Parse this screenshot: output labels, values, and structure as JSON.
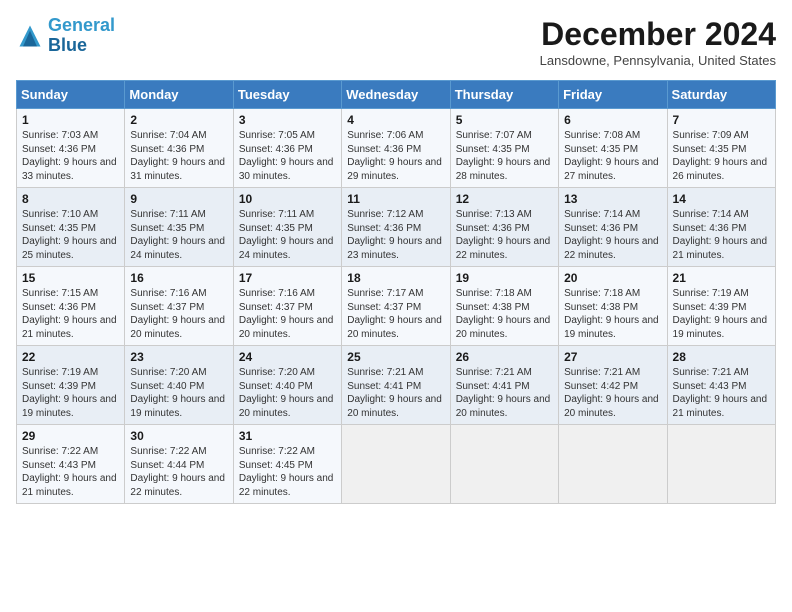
{
  "header": {
    "logo_line1": "General",
    "logo_line2": "Blue",
    "month_title": "December 2024",
    "location": "Lansdowne, Pennsylvania, United States"
  },
  "weekdays": [
    "Sunday",
    "Monday",
    "Tuesday",
    "Wednesday",
    "Thursday",
    "Friday",
    "Saturday"
  ],
  "weeks": [
    [
      {
        "day": "1",
        "sunrise": "7:03 AM",
        "sunset": "4:36 PM",
        "daylight": "9 hours and 33 minutes."
      },
      {
        "day": "2",
        "sunrise": "7:04 AM",
        "sunset": "4:36 PM",
        "daylight": "9 hours and 31 minutes."
      },
      {
        "day": "3",
        "sunrise": "7:05 AM",
        "sunset": "4:36 PM",
        "daylight": "9 hours and 30 minutes."
      },
      {
        "day": "4",
        "sunrise": "7:06 AM",
        "sunset": "4:36 PM",
        "daylight": "9 hours and 29 minutes."
      },
      {
        "day": "5",
        "sunrise": "7:07 AM",
        "sunset": "4:35 PM",
        "daylight": "9 hours and 28 minutes."
      },
      {
        "day": "6",
        "sunrise": "7:08 AM",
        "sunset": "4:35 PM",
        "daylight": "9 hours and 27 minutes."
      },
      {
        "day": "7",
        "sunrise": "7:09 AM",
        "sunset": "4:35 PM",
        "daylight": "9 hours and 26 minutes."
      }
    ],
    [
      {
        "day": "8",
        "sunrise": "7:10 AM",
        "sunset": "4:35 PM",
        "daylight": "9 hours and 25 minutes."
      },
      {
        "day": "9",
        "sunrise": "7:11 AM",
        "sunset": "4:35 PM",
        "daylight": "9 hours and 24 minutes."
      },
      {
        "day": "10",
        "sunrise": "7:11 AM",
        "sunset": "4:35 PM",
        "daylight": "9 hours and 24 minutes."
      },
      {
        "day": "11",
        "sunrise": "7:12 AM",
        "sunset": "4:36 PM",
        "daylight": "9 hours and 23 minutes."
      },
      {
        "day": "12",
        "sunrise": "7:13 AM",
        "sunset": "4:36 PM",
        "daylight": "9 hours and 22 minutes."
      },
      {
        "day": "13",
        "sunrise": "7:14 AM",
        "sunset": "4:36 PM",
        "daylight": "9 hours and 22 minutes."
      },
      {
        "day": "14",
        "sunrise": "7:14 AM",
        "sunset": "4:36 PM",
        "daylight": "9 hours and 21 minutes."
      }
    ],
    [
      {
        "day": "15",
        "sunrise": "7:15 AM",
        "sunset": "4:36 PM",
        "daylight": "9 hours and 21 minutes."
      },
      {
        "day": "16",
        "sunrise": "7:16 AM",
        "sunset": "4:37 PM",
        "daylight": "9 hours and 20 minutes."
      },
      {
        "day": "17",
        "sunrise": "7:16 AM",
        "sunset": "4:37 PM",
        "daylight": "9 hours and 20 minutes."
      },
      {
        "day": "18",
        "sunrise": "7:17 AM",
        "sunset": "4:37 PM",
        "daylight": "9 hours and 20 minutes."
      },
      {
        "day": "19",
        "sunrise": "7:18 AM",
        "sunset": "4:38 PM",
        "daylight": "9 hours and 20 minutes."
      },
      {
        "day": "20",
        "sunrise": "7:18 AM",
        "sunset": "4:38 PM",
        "daylight": "9 hours and 19 minutes."
      },
      {
        "day": "21",
        "sunrise": "7:19 AM",
        "sunset": "4:39 PM",
        "daylight": "9 hours and 19 minutes."
      }
    ],
    [
      {
        "day": "22",
        "sunrise": "7:19 AM",
        "sunset": "4:39 PM",
        "daylight": "9 hours and 19 minutes."
      },
      {
        "day": "23",
        "sunrise": "7:20 AM",
        "sunset": "4:40 PM",
        "daylight": "9 hours and 19 minutes."
      },
      {
        "day": "24",
        "sunrise": "7:20 AM",
        "sunset": "4:40 PM",
        "daylight": "9 hours and 20 minutes."
      },
      {
        "day": "25",
        "sunrise": "7:21 AM",
        "sunset": "4:41 PM",
        "daylight": "9 hours and 20 minutes."
      },
      {
        "day": "26",
        "sunrise": "7:21 AM",
        "sunset": "4:41 PM",
        "daylight": "9 hours and 20 minutes."
      },
      {
        "day": "27",
        "sunrise": "7:21 AM",
        "sunset": "4:42 PM",
        "daylight": "9 hours and 20 minutes."
      },
      {
        "day": "28",
        "sunrise": "7:21 AM",
        "sunset": "4:43 PM",
        "daylight": "9 hours and 21 minutes."
      }
    ],
    [
      {
        "day": "29",
        "sunrise": "7:22 AM",
        "sunset": "4:43 PM",
        "daylight": "9 hours and 21 minutes."
      },
      {
        "day": "30",
        "sunrise": "7:22 AM",
        "sunset": "4:44 PM",
        "daylight": "9 hours and 22 minutes."
      },
      {
        "day": "31",
        "sunrise": "7:22 AM",
        "sunset": "4:45 PM",
        "daylight": "9 hours and 22 minutes."
      },
      null,
      null,
      null,
      null
    ]
  ]
}
